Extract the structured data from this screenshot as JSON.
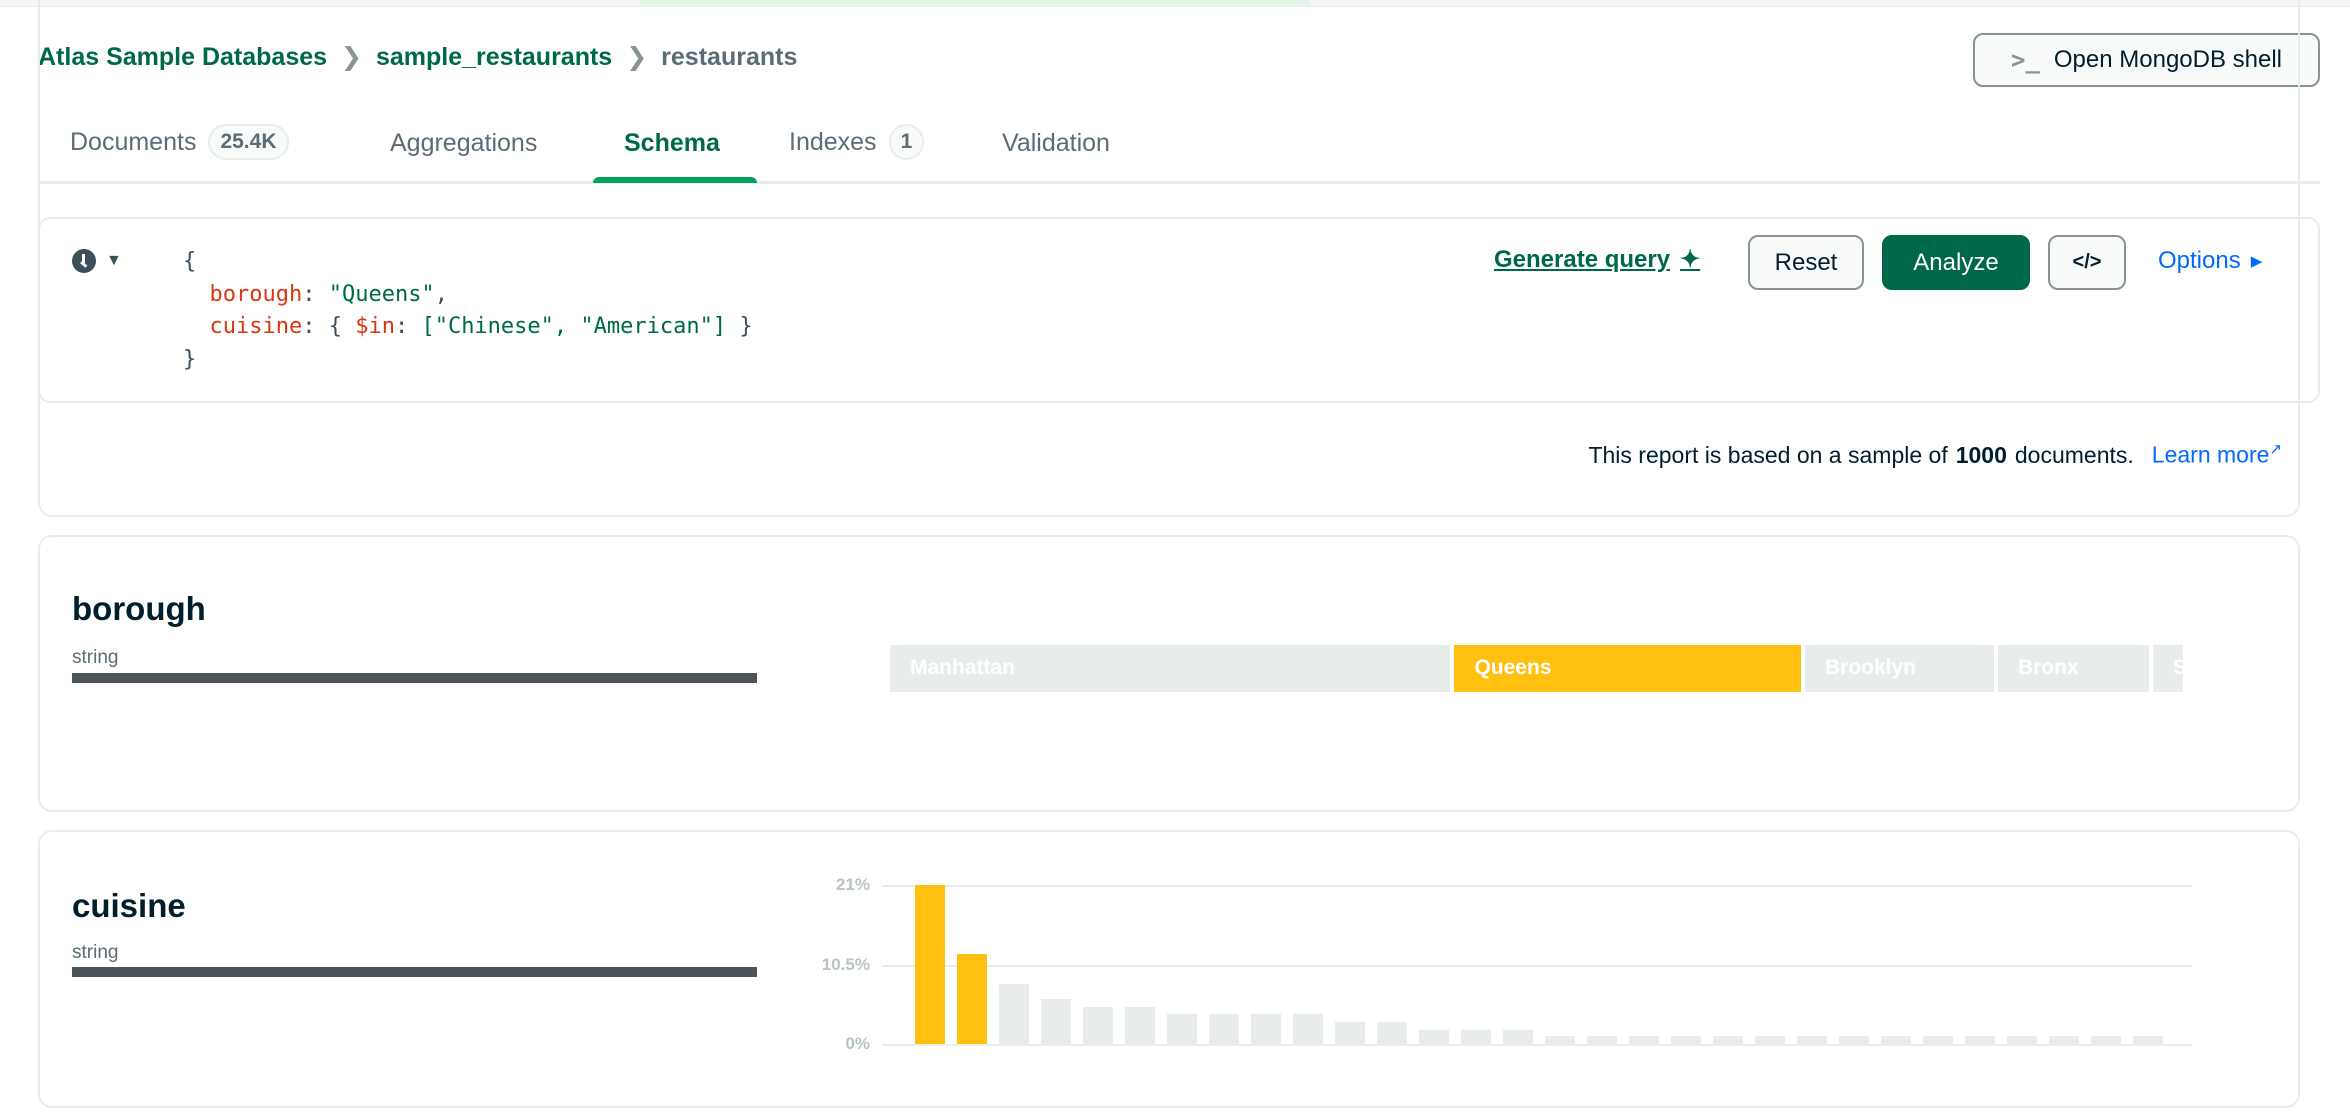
{
  "breadcrumb": [
    "Atlas Sample Databases",
    "sample_restaurants",
    "restaurants"
  ],
  "shell_button": {
    "label": "Open MongoDB shell",
    "icon": "terminal-icon"
  },
  "tabs": [
    {
      "label": "Documents",
      "badge": "25.4K"
    },
    {
      "label": "Aggregations"
    },
    {
      "label": "Schema",
      "active": true
    },
    {
      "label": "Indexes",
      "badge": "1"
    },
    {
      "label": "Validation"
    }
  ],
  "query": {
    "open": "{",
    "line1_key": "borough",
    "line1_val": "\"Queens\"",
    "line2_key": "cuisine",
    "line2_op": "$in",
    "line2_vals": "[\"Chinese\", \"American\"]",
    "close": "}"
  },
  "toolbar": {
    "generate": "Generate query",
    "reset": "Reset",
    "analyze": "Analyze",
    "options": "Options"
  },
  "report": {
    "prefix": "This report is based on a sample of",
    "count": "1000",
    "suffix": "documents.",
    "learn_more": "Learn more"
  },
  "colors": {
    "brand_green": "#00684a",
    "accent_green": "#00a35c",
    "highlight": "#ffc010",
    "muted_bar": "#e8edeb",
    "link": "#016bf8"
  },
  "fields": [
    {
      "name": "borough",
      "type": "string"
    },
    {
      "name": "cuisine",
      "type": "string"
    }
  ],
  "chart_data": [
    {
      "type": "bar",
      "orientation": "stacked-horizontal",
      "field": "borough",
      "categories": [
        "Manhattan",
        "Queens",
        "Brooklyn",
        "Bronx",
        "Staten Island"
      ],
      "values": [
        43,
        26.7,
        14.7,
        11.8,
        2.6
      ],
      "highlighted": [
        "Queens"
      ]
    },
    {
      "type": "bar",
      "field": "cuisine",
      "ylim": [
        0,
        21
      ],
      "yticks": [
        "21%",
        "10.5%",
        "0%"
      ],
      "grid": true,
      "values": [
        21,
        11.9,
        7.9,
        6.0,
        4.9,
        4.9,
        3.9,
        3.9,
        3.9,
        3.9,
        2.9,
        2.9,
        1.9,
        1.9,
        1.9,
        1,
        1,
        1,
        1,
        1,
        1,
        1,
        1,
        1,
        1,
        1,
        1,
        1,
        1,
        1
      ],
      "highlighted_indices": [
        0,
        1
      ]
    }
  ]
}
